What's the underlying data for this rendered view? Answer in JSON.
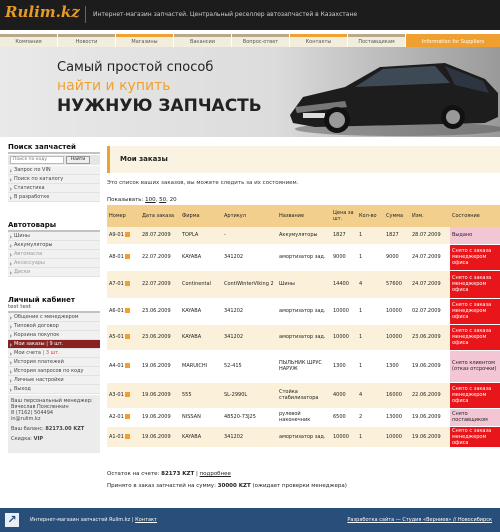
{
  "header": {
    "logo": "Rulim.kz",
    "tagline": "Интернет-магазин запчастей. Центральный реселлер автозапчастей в Казахстане"
  },
  "nav": [
    "Компания",
    "Новости",
    "Магазины",
    "Вакансии",
    "Вопрос-ответ",
    "Контакты",
    "Поставщикам",
    "Information for Suppliers"
  ],
  "banner": {
    "line1": "Самый простой способ",
    "line2": "найти и купить",
    "line3": "НУЖНУЮ ЗАПЧАСТЬ"
  },
  "sidebar": {
    "search_title": "Поиск запчастей",
    "search_placeholder": "Поиск по коду",
    "search_button": "Найти",
    "search_links": [
      "Запрос по VIN",
      "Поиск по каталогу",
      "Статистика",
      "В разработке"
    ],
    "auto_title": "Автотовары",
    "auto_links": [
      "Шины",
      "Аккумуляторы",
      "Автомасла",
      "Аксессуары",
      "Диски"
    ],
    "cab_title": "Личный кабинет",
    "cab_user": "test test",
    "cab_links": [
      "Общение с менеджером",
      "Типовой договор",
      "Корзина покупок",
      "Мои заказы",
      "Мои счета",
      "История платежей",
      "История запросов по коду",
      "Личные настройки",
      "Выход"
    ],
    "orders_count": "| 9 шт.",
    "bills_count": "| 3 шт.",
    "manager_label": "Ваш персональный менеджер:",
    "manager_name": "Вячеслав Поясленкин",
    "manager_phone": "8 (7162) 504494",
    "manager_email": "in@rulim.kz",
    "balance_label": "Ваш баланс:",
    "balance": "82173.00 KZT",
    "discount_label": "Скидка:",
    "discount": "VIP"
  },
  "main": {
    "title": "Мои заказы",
    "intro": "Это список ваших заказов, вы можете следить за их состоянием.",
    "show_label": "Показывать:",
    "show_options": [
      "100",
      "50",
      "20"
    ],
    "columns": [
      "Номер",
      "Дата заказа",
      "Фирма",
      "Артикул",
      "Название",
      "Цена за шт.",
      "Кол-во",
      "Сумма",
      "Изм.",
      "Состояние"
    ],
    "rows": [
      {
        "num": "А9-01",
        "date": "28.07.2009",
        "firm": "TOPLA",
        "art": "-",
        "name": "Аккумуляторы",
        "price": "1827",
        "qty": "1",
        "sum": "1827",
        "changed": "28.07.2009",
        "state": "Выдано",
        "st": "pink"
      },
      {
        "num": "А8-01",
        "date": "22.07.2009",
        "firm": "KAYABA",
        "art": "341202",
        "name": "амортизатор зад.",
        "price": "9000",
        "qty": "1",
        "sum": "9000",
        "changed": "24.07.2009",
        "state": "Снято с заказа менеджером офиса",
        "st": "red"
      },
      {
        "num": "А7-01",
        "date": "22.07.2009",
        "firm": "Continental",
        "art": "ContiWinterViking 2",
        "name": "Шины",
        "price": "14400",
        "qty": "4",
        "sum": "57600",
        "changed": "24.07.2009",
        "state": "Снято с заказа менеджером офиса",
        "st": "red"
      },
      {
        "num": "А6-01",
        "date": "23.06.2009",
        "firm": "KAYABA",
        "art": "341202",
        "name": "амортизатор зад.",
        "price": "10000",
        "qty": "1",
        "sum": "10000",
        "changed": "02.07.2009",
        "state": "Снято с заказа менеджером офиса",
        "st": "red"
      },
      {
        "num": "А5-01",
        "date": "23.06.2009",
        "firm": "KAYABA",
        "art": "341202",
        "name": "амортизатор зад.",
        "price": "10000",
        "qty": "1",
        "sum": "10000",
        "changed": "23.06.2009",
        "state": "Снято с заказа менеджером офиса",
        "st": "red"
      },
      {
        "num": "А4-01",
        "date": "19.06.2009",
        "firm": "MARUICHI",
        "art": "52-415",
        "name": "ПЫЛЬНИК ШРУС НАРУЖ",
        "price": "1300",
        "qty": "1",
        "sum": "1300",
        "changed": "19.06.2009",
        "state": "Снято клиентом (отказ отсрочки)",
        "st": "pink"
      },
      {
        "num": "А3-01",
        "date": "19.06.2009",
        "firm": "555",
        "art": "SL-2990L",
        "name": "Стойка стабилизатора",
        "price": "4000",
        "qty": "4",
        "sum": "16000",
        "changed": "22.06.2009",
        "state": "Снято с заказа менеджером офиса",
        "st": "red"
      },
      {
        "num": "А2-01",
        "date": "19.06.2009",
        "firm": "NISSAN",
        "art": "48520-73J25",
        "name": "рулевой наконечник",
        "price": "6500",
        "qty": "2",
        "sum": "13000",
        "changed": "19.06.2009",
        "state": "Снято поставщиком",
        "st": "pink"
      },
      {
        "num": "А1-01",
        "date": "19.06.2009",
        "firm": "KAYABA",
        "art": "341202",
        "name": "амортизатор зад.",
        "price": "10000",
        "qty": "1",
        "sum": "10000",
        "changed": "19.06.2009",
        "state": "Снято с заказа менеджером офиса",
        "st": "red"
      }
    ],
    "balance_label": "Остаток на счете:",
    "balance": "82173 KZT",
    "balance_link": "подробнее",
    "accepted_label": "Принято в заказ запчастей на сумму:",
    "accepted": "30000 KZT",
    "accepted_note": "(ожидает проверки менеджера)"
  },
  "footer": {
    "left": "Интернет-магазин запчастей Rulim.kz",
    "contact": "Контакт",
    "right": "Разработка сайта — Студия «Верниев» // Новосибирск"
  }
}
